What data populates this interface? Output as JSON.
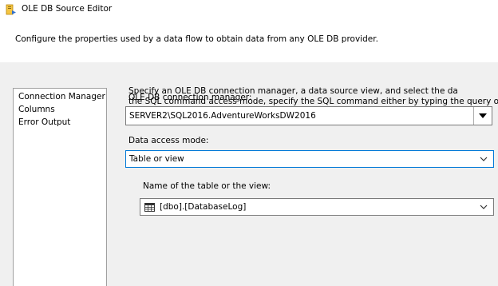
{
  "window": {
    "title": "OLE DB Source Editor",
    "icon": "ole-db-source-icon"
  },
  "header": {
    "description": "Configure the properties used by a data flow to obtain data from any OLE DB provider."
  },
  "nav": {
    "items": [
      {
        "label": "Connection Manager",
        "selected": true
      },
      {
        "label": "Columns"
      },
      {
        "label": "Error Output"
      }
    ]
  },
  "content": {
    "description_line1": "Specify an OLE DB connection manager, a data source view, and select the da",
    "description_line2": "the SQL command access mode, specify the SQL command either by typing the query or by u",
    "connection_manager": {
      "label": "OLE DB connection manager:",
      "value": "SERVER2\\SQL2016.AdventureWorksDW2016"
    },
    "data_access_mode": {
      "label": "Data access mode:",
      "value": "Table or view"
    },
    "table_name": {
      "label": "Name of the table or the view:",
      "value": "[dbo].[DatabaseLog]",
      "icon": "table-icon"
    }
  }
}
